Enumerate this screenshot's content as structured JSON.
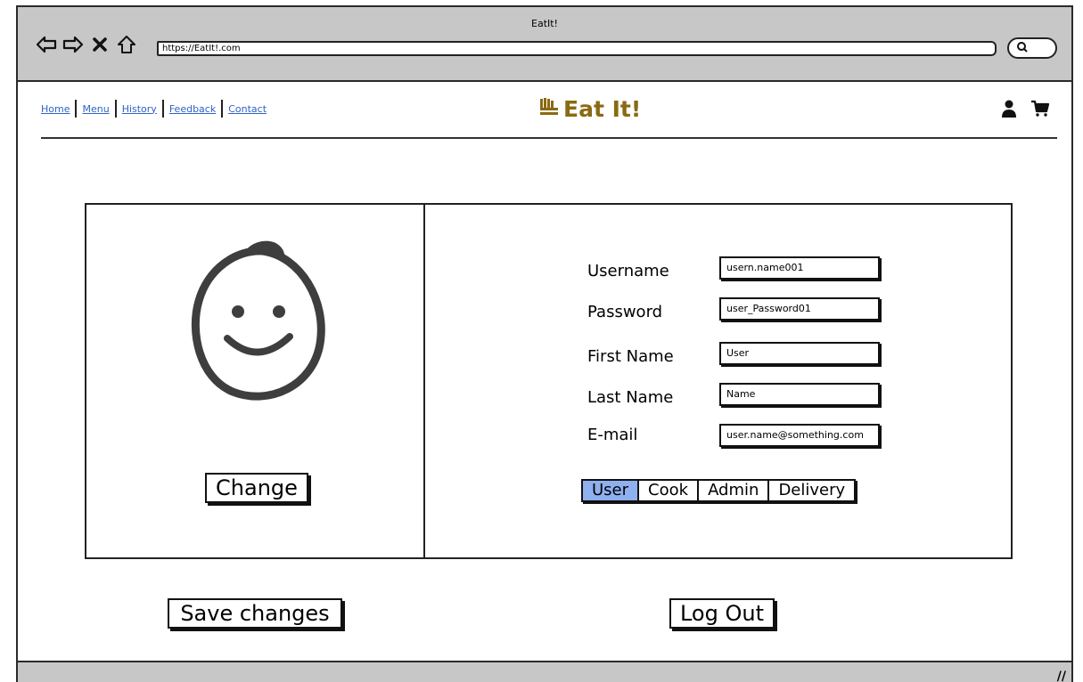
{
  "browser": {
    "window_title": "EatIt!",
    "url": "https://EatIt!.com",
    "icons": [
      "back-arrow-icon",
      "forward-arrow-icon",
      "stop-icon",
      "home-icon",
      "search-icon"
    ]
  },
  "site_nav": {
    "items": [
      "Home",
      "Menu",
      "History",
      "Feedback",
      "Contact"
    ]
  },
  "logo": {
    "icon": "hand-icon",
    "text": "Eat It!",
    "color": "#8a6a12"
  },
  "header_icons": [
    "user-icon",
    "cart-icon"
  ],
  "profile": {
    "avatar_icon": "smiley-face-icon",
    "change_label": "Change",
    "fields": [
      {
        "label": "Username",
        "value": "usern.name001"
      },
      {
        "label": "Password",
        "value": "user_Password01"
      },
      {
        "label": "First Name",
        "value": "User"
      },
      {
        "label": "Last Name",
        "value": "Name"
      },
      {
        "label": "E-mail",
        "value": "user.name@something.com"
      }
    ],
    "roles": [
      "User",
      "Cook",
      "Admin",
      "Delivery"
    ],
    "selected_role": "User",
    "selected_color": "#8fb0ef"
  },
  "actions": {
    "save_label": "Save changes",
    "logout_label": "Log Out"
  }
}
